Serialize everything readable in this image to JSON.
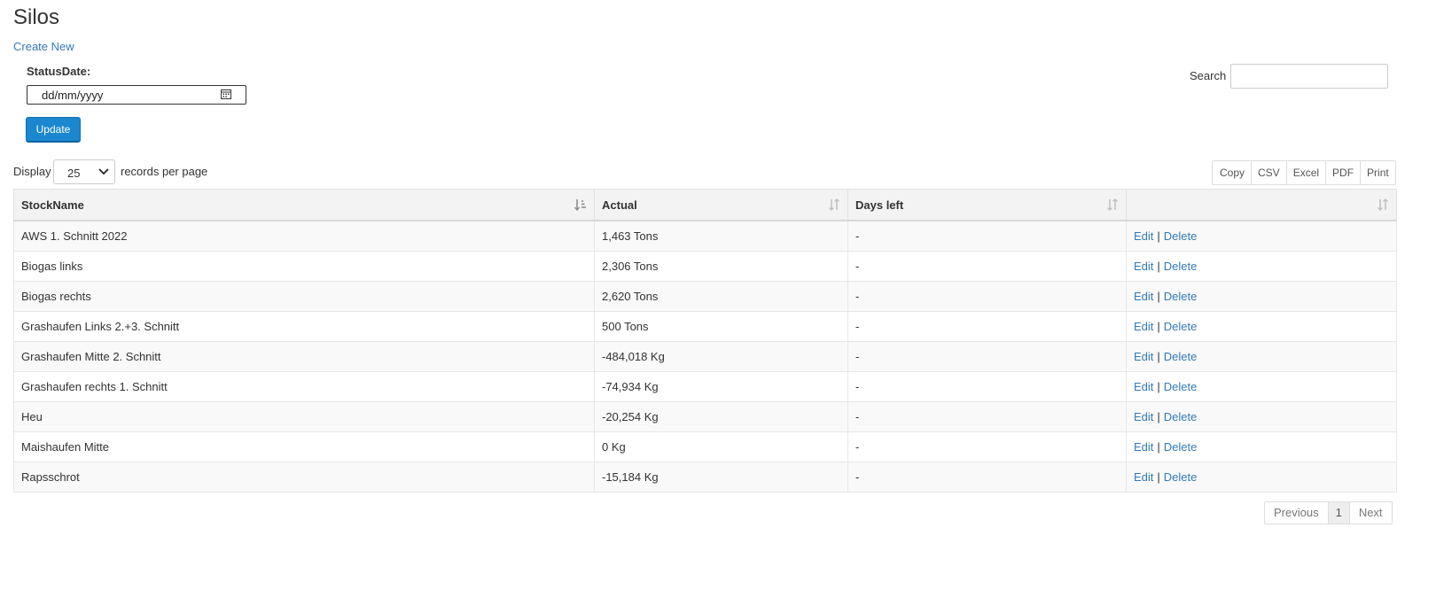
{
  "page": {
    "title": "Silos",
    "create_new": "Create New"
  },
  "filter": {
    "status_date_label": "StatusDate:",
    "status_date_placeholder": "dd/mm/yyyy",
    "update_label": "Update"
  },
  "search": {
    "label": "Search"
  },
  "length": {
    "display_label": "Display",
    "selected": "25",
    "suffix": "records per page"
  },
  "export_buttons": [
    "Copy",
    "CSV",
    "Excel",
    "PDF",
    "Print"
  ],
  "table": {
    "columns": [
      "StockName",
      "Actual",
      "Days left",
      ""
    ],
    "action_edit": "Edit",
    "action_sep": "|",
    "action_delete": "Delete",
    "rows": [
      {
        "name": "AWS 1. Schnitt 2022",
        "actual": "1,463 Tons",
        "days_left": "-"
      },
      {
        "name": "Biogas links",
        "actual": "2,306 Tons",
        "days_left": "-"
      },
      {
        "name": "Biogas rechts",
        "actual": "2,620 Tons",
        "days_left": "-"
      },
      {
        "name": "Grashaufen Links 2.+3. Schnitt",
        "actual": "500 Tons",
        "days_left": "-"
      },
      {
        "name": "Grashaufen Mitte 2. Schnitt",
        "actual": "-484,018 Kg",
        "days_left": "-"
      },
      {
        "name": "Grashaufen rechts 1. Schnitt",
        "actual": "-74,934 Kg",
        "days_left": "-"
      },
      {
        "name": "Heu",
        "actual": "-20,254 Kg",
        "days_left": "-"
      },
      {
        "name": "Maishaufen Mitte",
        "actual": "0 Kg",
        "days_left": "-"
      },
      {
        "name": "Rapsschrot",
        "actual": "-15,184 Kg",
        "days_left": "-"
      }
    ]
  },
  "pager": {
    "previous": "Previous",
    "current": "1",
    "next": "Next"
  },
  "colors": {
    "link": "#337ab7",
    "primary_button": "#1a87d0"
  },
  "icons": {
    "calendar": "calendar-icon",
    "chevron": "chevron-down-icon",
    "sort_active": "sort-ascending-icon",
    "sort": "sort-both-icon"
  }
}
